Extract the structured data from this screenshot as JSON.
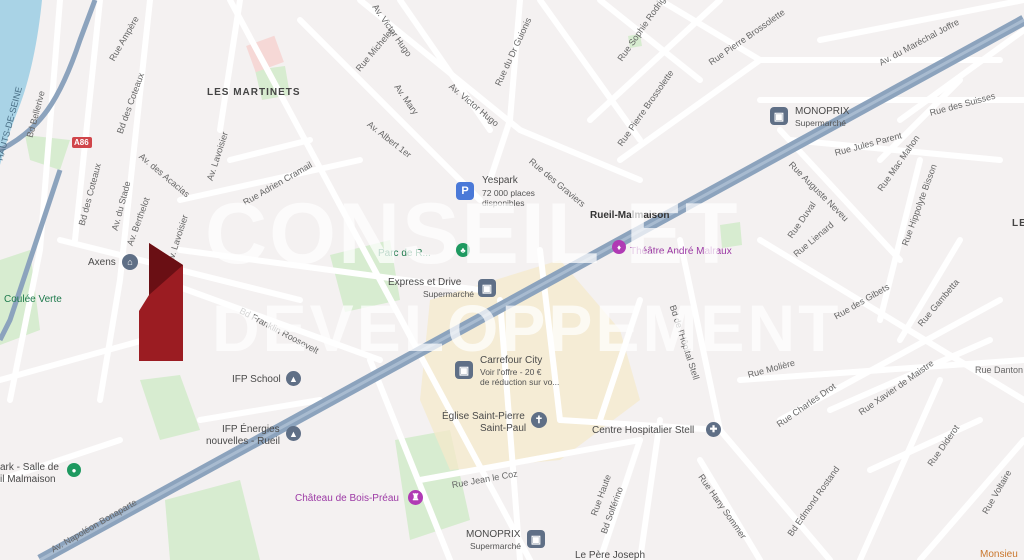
{
  "districts": {
    "les_martinets": "LES MARTINETS",
    "partial_right": "LE"
  },
  "streets": {
    "rue_ampere": "Rue Ampère",
    "bd_des_coteaux_top": "Bd des Coteaux",
    "bd_des_coteaux_left": "Bd des Coteaux",
    "bd_belleriv": "Bd Bellerive",
    "hauts_de_seine": "HAUTS-DE-SEINE",
    "av_des_acacias": "Av. des Acacias",
    "av_du_stade": "Av. du Stade",
    "av_lavoisier_top": "Av. Lavoisier",
    "av_lavoisier_mid": "Av. Lavoisier",
    "av_berthelot": "Av. Berthelot",
    "rue_adrien_cramail": "Rue Adrien Cramail",
    "av_albert_1er": "Av. Albert 1er",
    "av_victor_hugo": "Av. Victor Hugo",
    "av_victor_hugo_top": "Av. Victor Hugo",
    "rue_michelet": "Rue Michelet",
    "av_mary": "Av. Mary",
    "rue_dr_guionis": "Rue du Dr Guionis",
    "rue_des_graviers": "Rue des Graviers",
    "rue_sophie_rodrigues": "Rue Sophie Rodrigues",
    "rue_pierre_brossolette": "Rue Pierre Brossolette",
    "rue_pierre_brossolette_2": "Rue Pierre Brossolette",
    "av_marechal_joffre": "Av. du Maréchal Joffre",
    "rue_des_suisses": "Rue des Suisses",
    "rue_jules_parent": "Rue Jules Parent",
    "rue_auguste_neveu": "Rue Auguste Neveu",
    "rue_mac_mahon": "Rue Mac Mahon",
    "rue_hippolyte_bisson": "Rue Hippolyte Bisson",
    "rue_gambetta": "Rue Gambetta",
    "rue_des_gibets": "Rue des Gibets",
    "rue_danton": "Rue Danton",
    "rue_moliere": "Rue Molière",
    "rue_charles_drot": "Rue Charles Drot",
    "rue_xavier_de_maistre": "Rue Xavier de Maistre",
    "rue_diderot": "Rue Diderot",
    "rue_voltaire": "Rue Voltaire",
    "bd_franklin_roosevelt": "Bd Franklin Roosevelt",
    "rue_jean_le_coz": "Rue Jean le Coz",
    "rue_haute": "Rue Haute",
    "bd_solferino": "Bd Solférino",
    "rue_hanriot": "Bd de l'Hôpital Stell",
    "rue_hany_sommer": "Rue Hany Sommer",
    "bd_edmond_rostand": "Bd Edmond Rostand",
    "av_napoleon_bonaparte": "Av. Napoléon Bonaparte",
    "rue_lienard": "Rue Lienard",
    "rue_dumas": "Rue Duval",
    "a86": "A86"
  },
  "pois": {
    "yespark": {
      "name": "Yespark",
      "sub1": "72 000 places",
      "sub2": "disponibles",
      "icon": "P"
    },
    "monoprix_top": {
      "name": "MONOPRIX",
      "sub": "Supermarché"
    },
    "rueil_malmaison": {
      "name": "Rueil-Malmaison"
    },
    "parc": {
      "name": "Parc de R..."
    },
    "theatre": {
      "name": "Théâtre André Malraux"
    },
    "express": {
      "name": "Express et Drive",
      "sub": "Supermarché"
    },
    "axens": {
      "name": "Axens"
    },
    "coulee_verte": {
      "name": "Coulée Verte"
    },
    "carrefour": {
      "name": "Carrefour City",
      "sub1": "Voir l'offre - 20 €",
      "sub2": "de réduction sur vo..."
    },
    "ifp_school": {
      "name": "IFP School"
    },
    "ifp_energies": {
      "name1": "IFP Énergies",
      "name2": "nouvelles - Rueil"
    },
    "eglise": {
      "name1": "Église Saint-Pierre",
      "name2": "Saint-Paul"
    },
    "centre_hospitalier": {
      "name": "Centre Hospitalier Stell"
    },
    "parc_salle": {
      "name1": "ark - Salle de",
      "name2": "il Malmaison"
    },
    "chateau": {
      "name": "Château de Bois-Préau"
    },
    "monoprix_bottom": {
      "name": "MONOPRIX",
      "sub": "Supermarché"
    },
    "pere_joseph": {
      "name": "Le Père Joseph"
    },
    "monsieur": {
      "name": "Monsieu"
    }
  },
  "watermark": {
    "line1": "CONSEIL ET",
    "line2": "DEVELOPPEMENT"
  },
  "colors": {
    "background": "#f4f1f1",
    "river": "#a9d3e6",
    "park": "#cde8c5",
    "highway": "#8ca3bd",
    "commercial": "#f6eacb",
    "poi_gray": "#5f6f86",
    "poi_purple": "#b03ab4",
    "poi_green": "#1e9960",
    "poi_blue": "#4a79d8",
    "logo_red": "#9b1c22"
  }
}
